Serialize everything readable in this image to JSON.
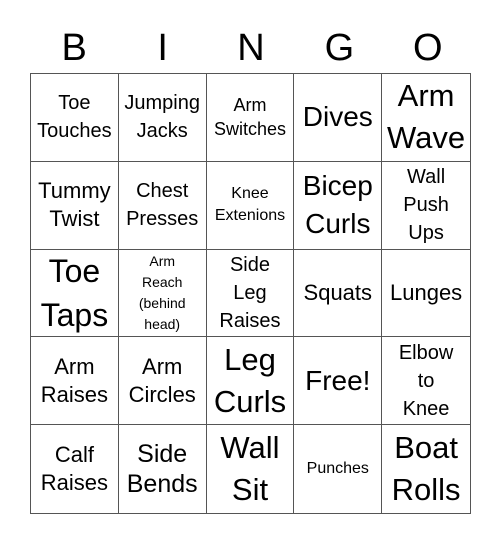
{
  "header": [
    "B",
    "I",
    "N",
    "G",
    "O"
  ],
  "cells": [
    "Toe\nTouches",
    "Jumping\nJacks",
    "Arm\nSwitches",
    "Dives",
    "Arm\nWave",
    "Tummy\nTwist",
    "Chest\nPresses",
    "Knee\nExtenions",
    "Bicep\nCurls",
    "Wall\nPush\nUps",
    "Toe\nTaps",
    "Arm\nReach\n(behind\nhead)",
    "Side\nLeg\nRaises",
    "Squats",
    "Lunges",
    "Arm\nRaises",
    "Arm\nCircles",
    "Leg\nCurls",
    "Free!",
    "Elbow\nto\nKnee",
    "Calf\nRaises",
    "Side\nBends",
    "Wall\nSit",
    "Punches",
    "Boat\nRolls"
  ]
}
